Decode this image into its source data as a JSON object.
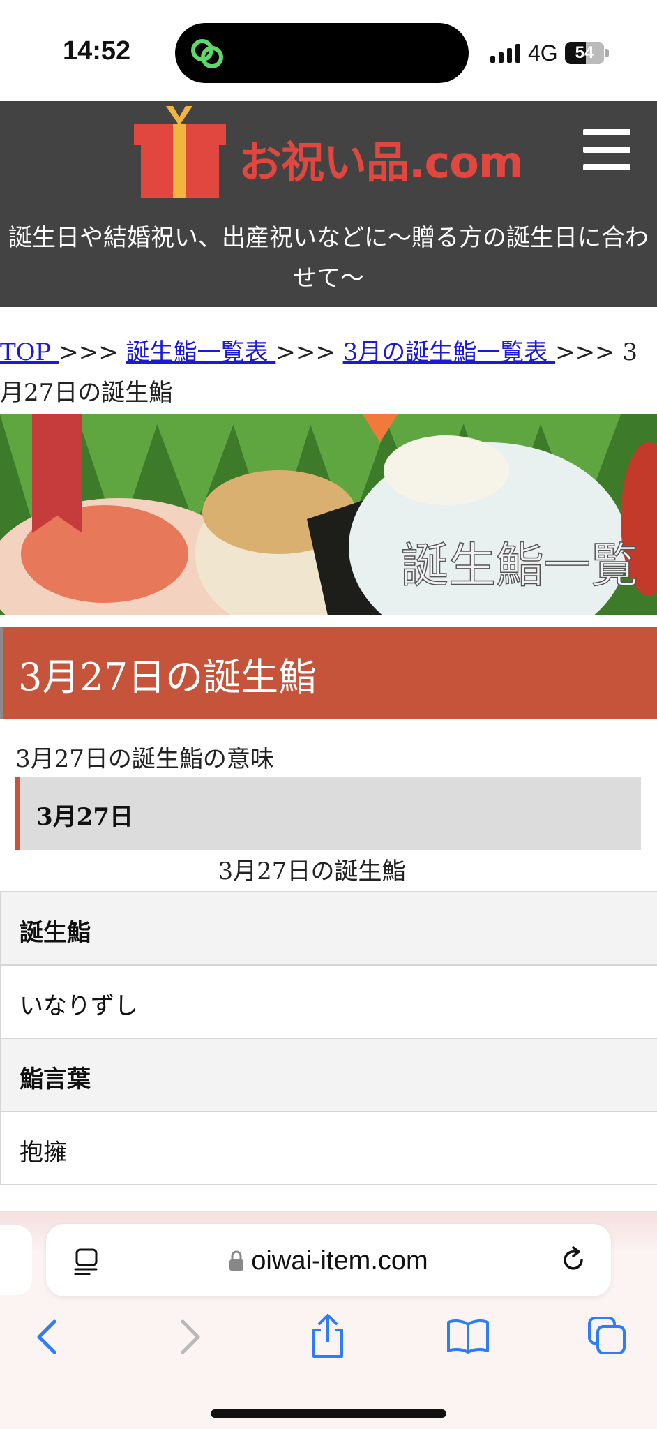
{
  "status_bar": {
    "time": "14:52",
    "network": "4G",
    "battery": "54",
    "battery_fraction": 0.54
  },
  "header": {
    "logo_text": "お祝い品.com",
    "tagline": "誕生日や結婚祝い、出産祝いなどに〜贈る方の誕生日に合わせて〜",
    "menu_icon": "hamburger-menu-icon"
  },
  "breadcrumb": {
    "items": [
      "TOP ",
      "誕生鮨一覧表 ",
      "3月の誕生鮨一覧表 "
    ],
    "separator": ">>>",
    "current": "3月27日の誕生鮨"
  },
  "banner": {
    "text": "誕生鮨一覧"
  },
  "main": {
    "heading": "3月27日の誕生鮨",
    "meaning_label": "3月27日の誕生鮨の意味",
    "date_box": "3月27日",
    "table_caption": "3月27日の誕生鮨",
    "rows": [
      {
        "label": "誕生鮨",
        "header": true
      },
      {
        "label": "いなりずし",
        "header": false
      },
      {
        "label": "鮨言葉",
        "header": true
      },
      {
        "label": "抱擁",
        "header": false
      }
    ]
  },
  "browser": {
    "url": "oiwai-item.com",
    "icons": [
      "reader-icon",
      "lock-icon",
      "reload-icon",
      "back-icon",
      "forward-icon",
      "share-icon",
      "bookmarks-icon",
      "tabs-icon"
    ]
  },
  "colors": {
    "header_bg": "#434343",
    "accent": "#c6543a",
    "link": "#1a1ad8",
    "logo_red": "#e2473f",
    "ios_blue": "#2f7df6"
  }
}
